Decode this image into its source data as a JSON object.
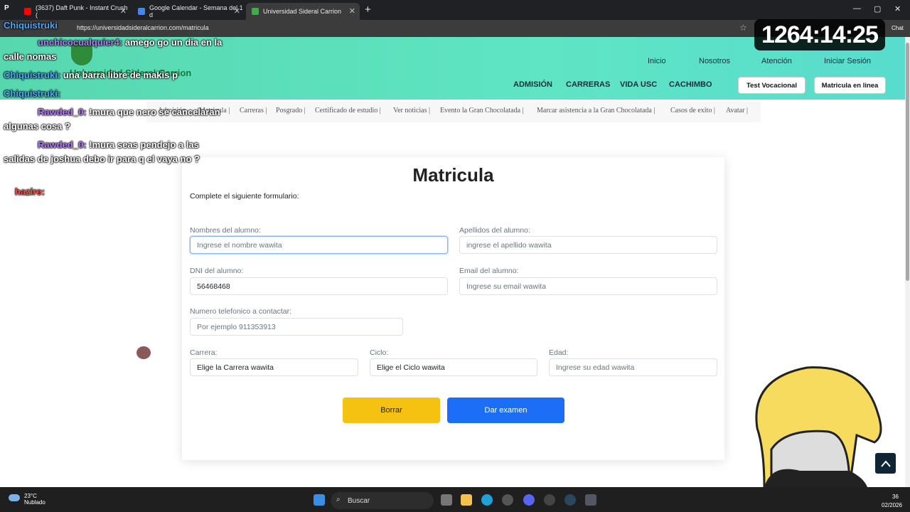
{
  "browser": {
    "tabs": [
      {
        "title": "(3637) Daft Punk - Instant Crush (",
        "color": "#ff0000"
      },
      {
        "title": "Google Calendar - Semana del 1 d",
        "color": "#4285f4"
      },
      {
        "title": "Universidad Sideral Carrion",
        "color": "#3fae49"
      }
    ],
    "url": "https://universidadsideralcarrion.com/matricula",
    "chat_label": "Chat"
  },
  "site": {
    "logo_text": "Universidad Sideral Carrion",
    "nav_top": [
      "Inicio",
      "Nosotros",
      "Atención",
      "Iniciar Sesión"
    ],
    "nav_main": [
      "ADMISIÓN",
      "CARRERAS",
      "VIDA USC",
      "CACHIMBO"
    ],
    "btn_test": "Test Vocacional",
    "btn_matricula": "Matricula en linea",
    "breadcrumb": [
      "Admisión",
      "Matricula |",
      "Carreras |",
      "Posgrado |",
      "Certificado de estudio |",
      "Ver noticias |",
      "Evento la Gran Chocolatada |",
      "Marcar asistencia a la Gran Chocolatada |",
      "Casos de exito |",
      "Avatar |"
    ]
  },
  "form": {
    "title": "Matricula",
    "subtitle": "Complete el siguiente formulario:",
    "nombres_label": "Nombres del alumno:",
    "nombres_placeholder": "Ingrese el nombre wawita",
    "apellidos_label": "Apellidos del alumno:",
    "apellidos_placeholder": "ingrese el apellido wawita",
    "dni_label": "DNI del alumno:",
    "dni_value": "56468468",
    "email_label": "Email del alumno:",
    "email_placeholder": "Ingrese su email wawita",
    "telefono_label": "Numero telefonico a contactar:",
    "telefono_placeholder": "Por ejemplo 911353913",
    "carrera_label": "Carrera:",
    "carrera_value": "Elige la Carrera wawita",
    "ciclo_label": "Ciclo:",
    "ciclo_value": "Elige el Ciclo wawita",
    "edad_label": "Edad:",
    "edad_placeholder": "Ingrese su edad wawita",
    "btn_borrar": "Borrar",
    "btn_examen": "Dar examen"
  },
  "overlay": {
    "timer": "1264:14:25",
    "chat": [
      {
        "user": "Chiquistruki",
        "text": "",
        "color": "#4aa8ff"
      },
      {
        "user": "unchicocualquier4:",
        "text": "amego go un dia en la calle nomas",
        "color": "#b27bff"
      },
      {
        "user": "Chiquistruki:",
        "text": "una barra libre de makis p",
        "color": "#4aa8ff"
      },
      {
        "user": "Chiquistruki:",
        "text": "",
        "color": "#4aa8ff"
      },
      {
        "user": "Rawded_0:",
        "text": "!mura que nero se cancelaran algunas cosa ?",
        "color": "#b27bff"
      },
      {
        "user": "Rawded_0:",
        "text": "!mura  seas pendejo a las salidas de joshua  debo ir para q el vaya no ?",
        "color": "#b27bff"
      },
      {
        "user": "hazire:",
        "text": "",
        "color": "#ff4a4a"
      }
    ]
  },
  "taskbar": {
    "temp": "23°C",
    "weather": "Nublado",
    "search": "Buscar",
    "clock_time": "36",
    "clock_date": "02/2026"
  }
}
